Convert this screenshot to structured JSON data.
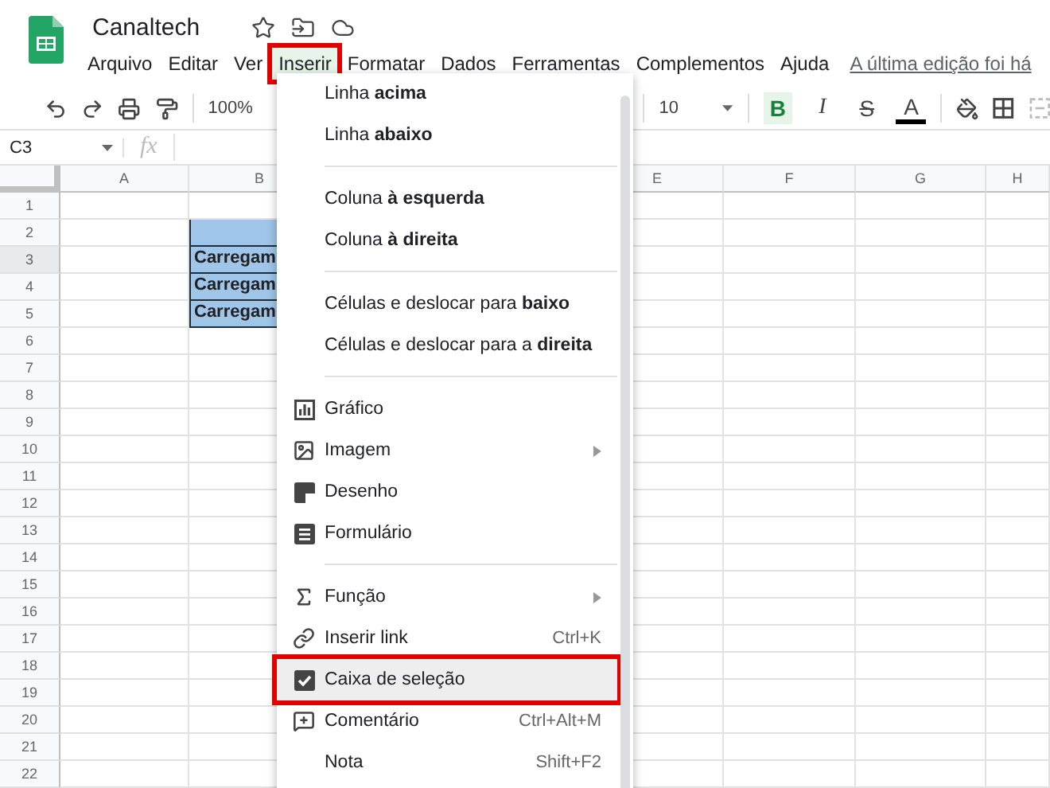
{
  "document": {
    "title": "Canaltech",
    "last_edit": "A última edição foi há"
  },
  "menubar": [
    {
      "label": "Arquivo",
      "selected": false,
      "annotated": false
    },
    {
      "label": "Editar",
      "selected": false,
      "annotated": false
    },
    {
      "label": "Ver",
      "selected": false,
      "annotated": false
    },
    {
      "label": "Inserir",
      "selected": true,
      "annotated": true
    },
    {
      "label": "Formatar",
      "selected": false,
      "annotated": false
    },
    {
      "label": "Dados",
      "selected": false,
      "annotated": false
    },
    {
      "label": "Ferramentas",
      "selected": false,
      "annotated": false
    },
    {
      "label": "Complementos",
      "selected": false,
      "annotated": false
    },
    {
      "label": "Ajuda",
      "selected": false,
      "annotated": false
    }
  ],
  "toolbar": {
    "zoom": "100%",
    "font_size": "10",
    "bold": {
      "label": "B",
      "on": true
    },
    "italic": "I",
    "strikethrough": "S",
    "text_color": "A"
  },
  "formula_bar": {
    "cell_ref": "C3",
    "fx": "fx"
  },
  "sheet": {
    "columns": [
      "A",
      "B",
      null,
      null,
      "E",
      "F",
      "G",
      "H"
    ],
    "rows": [
      {
        "number": "1",
        "selected": false,
        "cells": []
      },
      {
        "number": "2",
        "selected": false,
        "cells": [
          null,
          {
            "filled": true
          }
        ]
      },
      {
        "number": "3",
        "selected": true,
        "cells": [
          null,
          {
            "filled": true,
            "text": "Carregam"
          }
        ]
      },
      {
        "number": "4",
        "selected": false,
        "cells": [
          null,
          {
            "filled": true,
            "text": "Carregam"
          }
        ]
      },
      {
        "number": "5",
        "selected": false,
        "cells": [
          null,
          {
            "filled": true,
            "text": "Carregam"
          }
        ]
      },
      {
        "number": "6",
        "selected": false,
        "cells": []
      },
      {
        "number": "7",
        "selected": false,
        "cells": []
      },
      {
        "number": "8",
        "selected": false,
        "cells": []
      },
      {
        "number": "9",
        "selected": false,
        "cells": []
      },
      {
        "number": "10",
        "selected": false,
        "cells": []
      },
      {
        "number": "11",
        "selected": false,
        "cells": []
      },
      {
        "number": "12",
        "selected": false,
        "cells": []
      },
      {
        "number": "13",
        "selected": false,
        "cells": []
      },
      {
        "number": "14",
        "selected": false,
        "cells": []
      },
      {
        "number": "15",
        "selected": false,
        "cells": []
      },
      {
        "number": "16",
        "selected": false,
        "cells": []
      },
      {
        "number": "17",
        "selected": false,
        "cells": []
      },
      {
        "number": "18",
        "selected": false,
        "cells": []
      },
      {
        "number": "19",
        "selected": false,
        "cells": []
      },
      {
        "number": "20",
        "selected": false,
        "cells": []
      },
      {
        "number": "21",
        "selected": false,
        "cells": []
      },
      {
        "number": "22",
        "selected": false,
        "cells": []
      }
    ]
  },
  "insert_menu": [
    [
      {
        "label": "Linha **acima**",
        "submenu": false,
        "selected": false,
        "annotated": false
      },
      {
        "label": "Linha **abaixo**",
        "submenu": false,
        "selected": false,
        "annotated": false
      }
    ],
    [
      {
        "label": "Coluna **à esquerda**",
        "submenu": false,
        "selected": false,
        "annotated": false
      },
      {
        "label": "Coluna **à direita**",
        "submenu": false,
        "selected": false,
        "annotated": false
      }
    ],
    [
      {
        "label": "Células e deslocar para **baixo**",
        "submenu": false,
        "selected": false,
        "annotated": false
      },
      {
        "label": "Células e deslocar para a **direita**",
        "submenu": false,
        "selected": false,
        "annotated": false
      }
    ],
    [
      {
        "label": "Gráfico",
        "submenu": false,
        "selected": false,
        "annotated": false
      },
      {
        "label": "Imagem",
        "submenu": true,
        "selected": false,
        "annotated": false
      },
      {
        "label": "Desenho",
        "submenu": false,
        "selected": false,
        "annotated": false
      },
      {
        "label": "Formulário",
        "submenu": false,
        "selected": false,
        "annotated": false
      }
    ],
    [
      {
        "label": "Função",
        "submenu": true,
        "selected": false,
        "annotated": false
      },
      {
        "label": "Inserir link",
        "shortcut": "Ctrl+K",
        "submenu": false,
        "selected": false,
        "annotated": false
      },
      {
        "label": "Caixa de seleção",
        "submenu": false,
        "selected": true,
        "annotated": true
      },
      {
        "label": "Comentário",
        "shortcut": "Ctrl+Alt+M",
        "submenu": false,
        "selected": false,
        "annotated": false
      },
      {
        "label": "Nota",
        "shortcut": "Shift+F2",
        "submenu": false,
        "selected": false,
        "annotated": false
      }
    ]
  ]
}
